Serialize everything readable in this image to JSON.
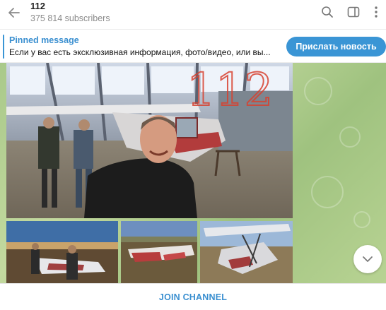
{
  "header": {
    "title": "112",
    "subtitle": "375 814 subscribers",
    "icons": [
      "back-arrow-icon",
      "search-icon",
      "sidebar-toggle-icon",
      "more-vertical-icon"
    ]
  },
  "pinned": {
    "title": "Pinned message",
    "text": "Если у вас есть эксклюзивная информация, фото/видео, или вы..."
  },
  "action_button": {
    "label": "Прислать новость"
  },
  "photos": {
    "main_watermark": "112"
  },
  "footer": {
    "join_label": "JOIN CHANNEL"
  },
  "colors": {
    "accent": "#3a95d5",
    "chat_background": "#a9c98a"
  }
}
